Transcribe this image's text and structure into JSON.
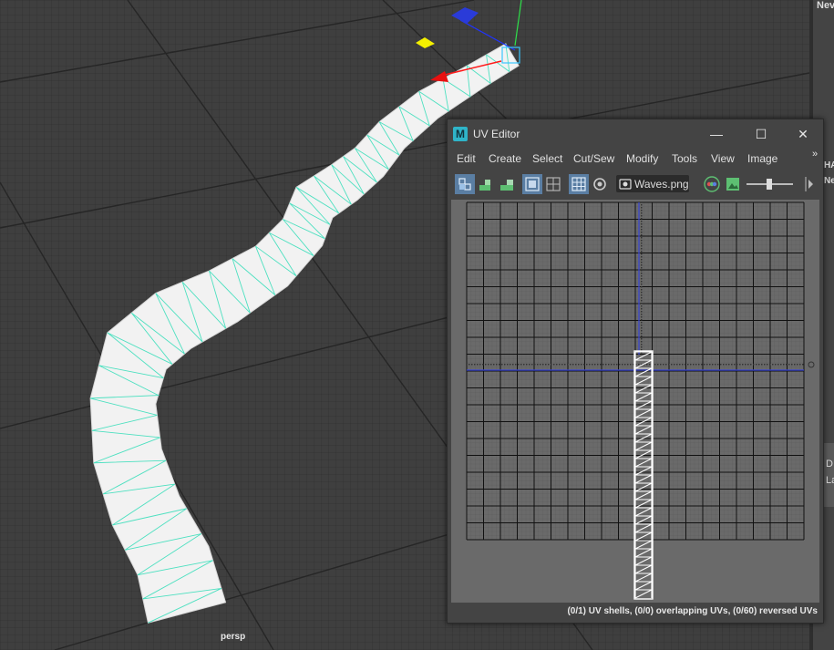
{
  "viewport": {
    "camera_label": "persp",
    "colors": {
      "grid_bg": "#3f3f3f",
      "mesh_fill": "#f2f2f2",
      "wire": "#4de0c0"
    }
  },
  "right_panel": {
    "partial_texts": [
      "Nev",
      "HA",
      "Ne",
      "D",
      "La"
    ]
  },
  "uv_editor": {
    "title": "UV Editor",
    "logo": "M",
    "window_buttons": {
      "minimize": "—",
      "maximize": "☐",
      "close": "✕"
    },
    "menu": [
      "Edit",
      "Create",
      "Select",
      "Cut/Sew",
      "Modify",
      "Tools",
      "View",
      "Image"
    ],
    "menu_overflow": "»",
    "toolbar": {
      "texture_name": "Waves.png",
      "icons": [
        "uv-shell-select-icon",
        "uv-unfold-icon",
        "uv-layout-icon",
        "shaded-uv-icon",
        "texture-borders-icon",
        "grid-toggle-icon",
        "snapshot-icon",
        "image-icon",
        "rgb-channels-icon",
        "display-image-icon",
        "exposure-slider",
        "toolbar-expand-icon"
      ]
    },
    "status": "(0/1) UV shells, (0/0) overlapping UVs, (0/60) reversed UVs",
    "colors": {
      "accent": "#5a7ea3",
      "axis": "#3a46d6"
    }
  }
}
